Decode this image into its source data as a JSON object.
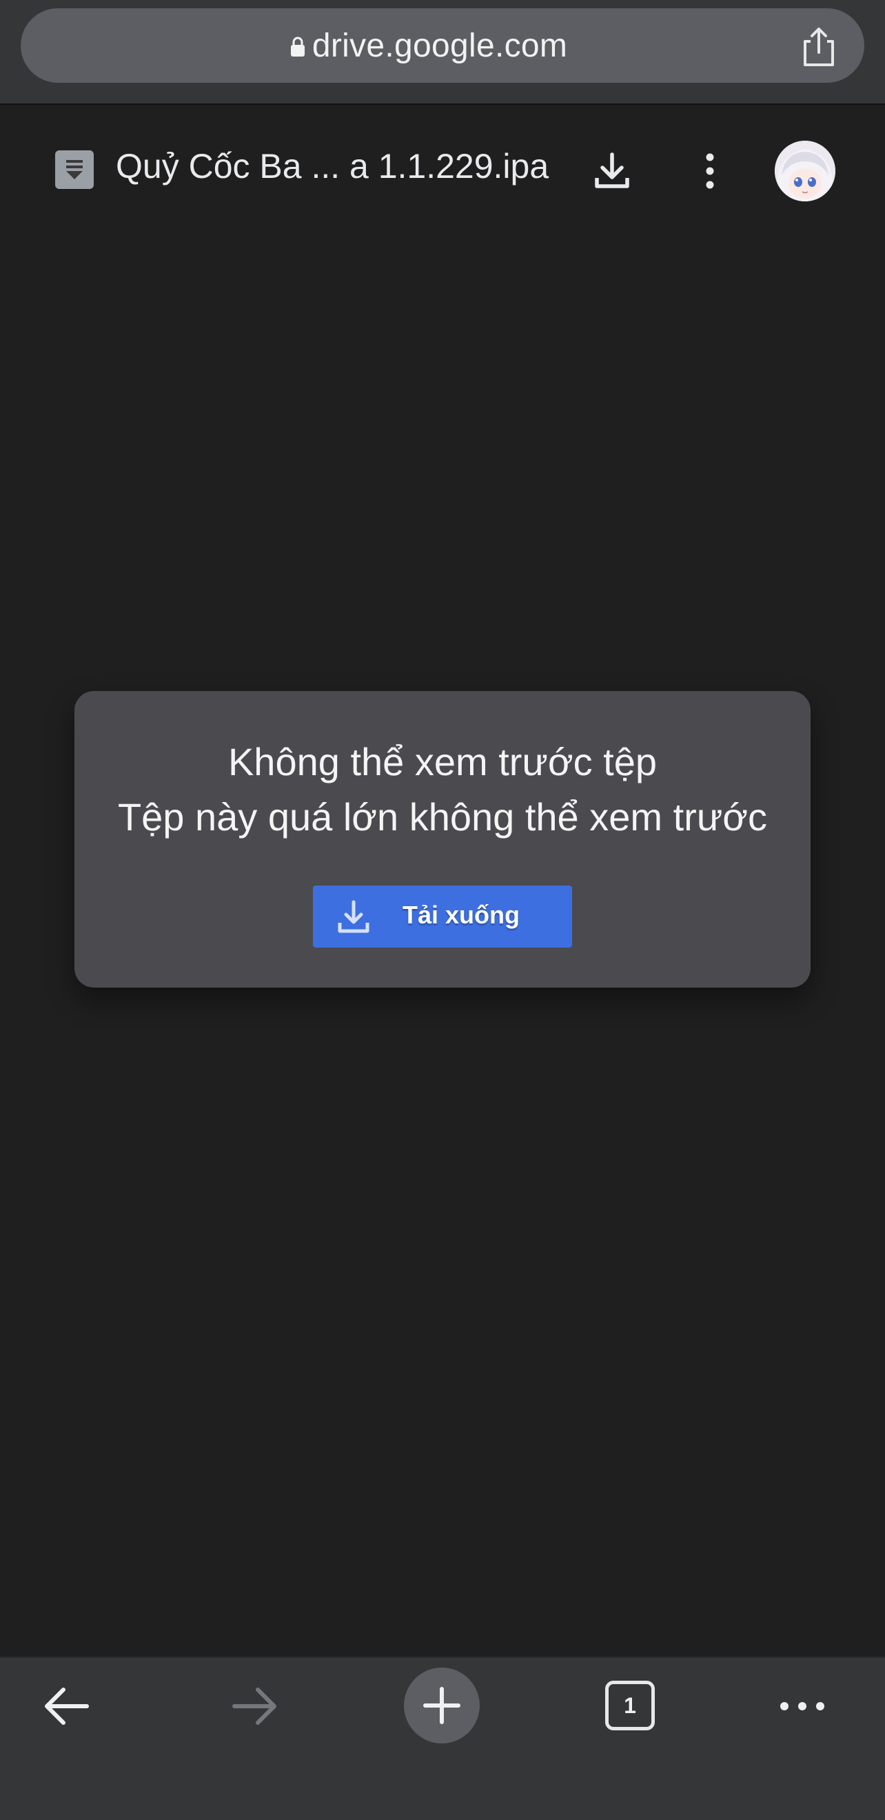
{
  "browser": {
    "url": "drive.google.com"
  },
  "drive_header": {
    "file_name": "Quỷ Cốc Ba ... a 1.1.229.ipa"
  },
  "preview": {
    "title": "Không thể xem trước tệp",
    "subtitle": "Tệp này quá lớn không thể xem trước",
    "download_label": "Tải xuống"
  },
  "toolbar": {
    "tab_count": "1"
  },
  "colors": {
    "page_background": "#1f1f1f",
    "browser_chrome": "#353638",
    "card_background": "#4b4a4f",
    "accent_blue": "#3d6fe0"
  },
  "icons": [
    "lock-icon",
    "share-icon",
    "file-icon",
    "download-icon",
    "more-vert-icon",
    "avatar",
    "download-icon",
    "back-arrow-icon",
    "forward-arrow-icon",
    "plus-icon",
    "tabs-icon",
    "more-horiz-icon"
  ]
}
